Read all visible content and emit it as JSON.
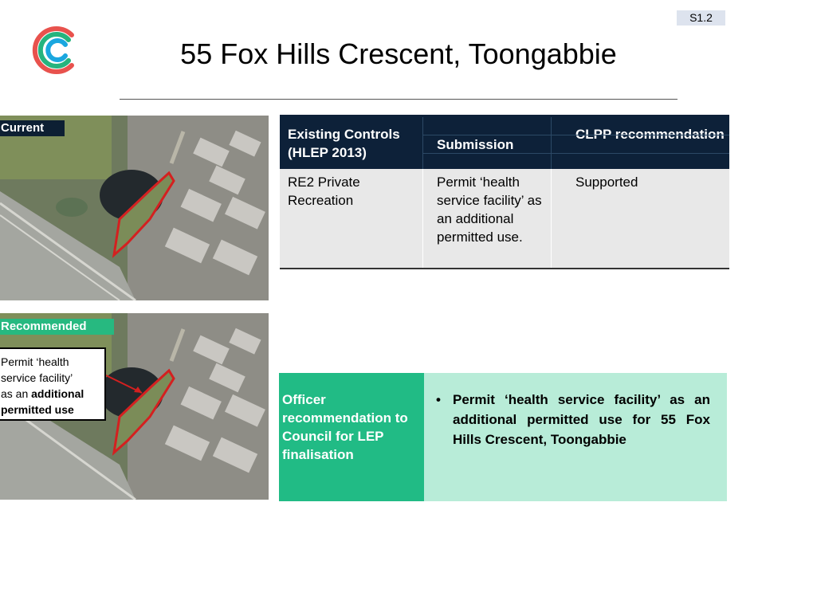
{
  "slide": {
    "id": "S1.2",
    "title": "55 Fox Hills Crescent, Toongabbie"
  },
  "brand": {
    "logo_colors": [
      "#e8524d",
      "#25b47e",
      "#1aa7df"
    ]
  },
  "images": {
    "current_tag": "Current",
    "recommended_tag": "Recommended",
    "callout": {
      "line1": "Permit ‘health",
      "line2": "service facility’",
      "line3_prefix": "as an ",
      "line3_bold": "additional",
      "line4": "permitted use"
    }
  },
  "controls_table": {
    "headers": {
      "existing": "Existing Controls (HLEP 2013)",
      "submission": "Submission",
      "clpp": "CLPP recommendation"
    },
    "row": {
      "existing": "RE2 Private Recreation",
      "submission": "Permit ‘health service facility’ as an additional permitted use.",
      "clpp": "Supported"
    }
  },
  "officer": {
    "label": "Officer recommendation to Council for LEP finalisation",
    "bullet": "•",
    "text": "Permit ‘health service facility’ as an additional permitted use for 55 Fox Hills Crescent, Toongabbie"
  }
}
